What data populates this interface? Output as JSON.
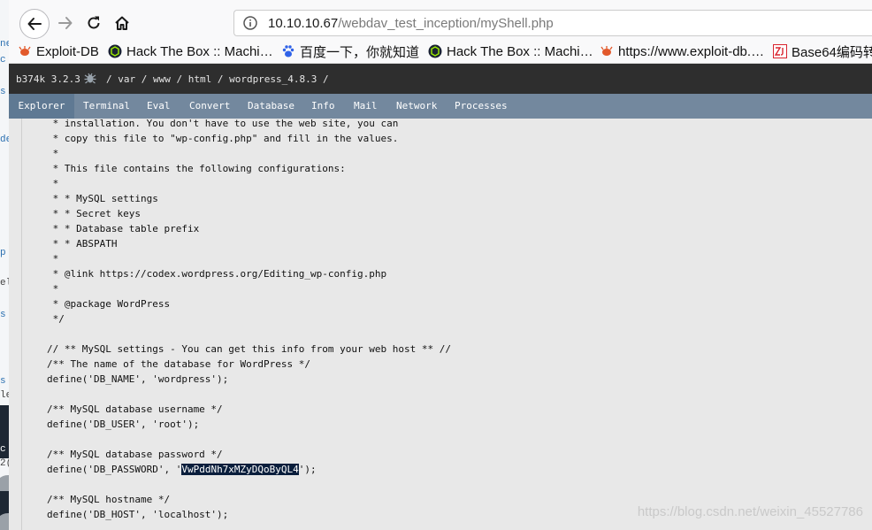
{
  "browser": {
    "url_host": "10.10.10.67",
    "url_path": "/webdav_test_inception/myShell.php"
  },
  "bookmarks": [
    {
      "label": "Exploit-DB",
      "icon": "exploitdb-icon",
      "color": "#e2592b"
    },
    {
      "label": "Hack The Box :: Machi…",
      "icon": "htb-icon",
      "color": "#9fef00"
    },
    {
      "label": "百度一下，你就知道",
      "icon": "baidu-paw-icon",
      "color": "#2f62e8"
    },
    {
      "label": "Hack The Box :: Machi…",
      "icon": "htb-icon",
      "color": "#9fef00"
    },
    {
      "label": "https://www.exploit-db.…",
      "icon": "exploitdb-icon",
      "color": "#e2592b"
    },
    {
      "label": "Base64编码转",
      "icon": "zj-icon",
      "color": "#d9232d"
    }
  ],
  "shell": {
    "brand": "b374k 3.2.3",
    "path": "/ var / www / html / wordpress_4.8.3 /",
    "menu": [
      "Explorer",
      "Terminal",
      "Eval",
      "Convert",
      "Database",
      "Info",
      "Mail",
      "Network",
      "Processes"
    ],
    "active_menu": "Explorer"
  },
  "code": {
    "lines": [
      " * installation. You don't have to use the web site, you can",
      " * copy this file to \"wp-config.php\" and fill in the values.",
      " *",
      " * This file contains the following configurations:",
      " *",
      " * * MySQL settings",
      " * * Secret keys",
      " * * Database table prefix",
      " * * ABSPATH",
      " *",
      " * @link https://codex.wordpress.org/Editing_wp-config.php",
      " *",
      " * @package WordPress",
      " */",
      "",
      "// ** MySQL settings - You can get this info from your web host ** //",
      "/** The name of the database for WordPress */",
      "define('DB_NAME', 'wordpress');",
      "",
      "/** MySQL database username */",
      "define('DB_USER', 'root');",
      "",
      "/** MySQL database password */",
      "PASSWORD_LINE",
      "",
      "/** MySQL hostname */",
      "define('DB_HOST', 'localhost');"
    ],
    "password_prefix": "define('DB_PASSWORD', '",
    "password_value": "VwPddNh7xMZyDQoByQL4",
    "password_suffix": "');"
  },
  "left_fragments": [
    "ne",
    "c",
    "de",
    "s",
    "p",
    "el",
    "s",
    "s",
    "le",
    "c",
    "2("
  ],
  "watermark": "https://blog.csdn.net/weixin_45527786"
}
